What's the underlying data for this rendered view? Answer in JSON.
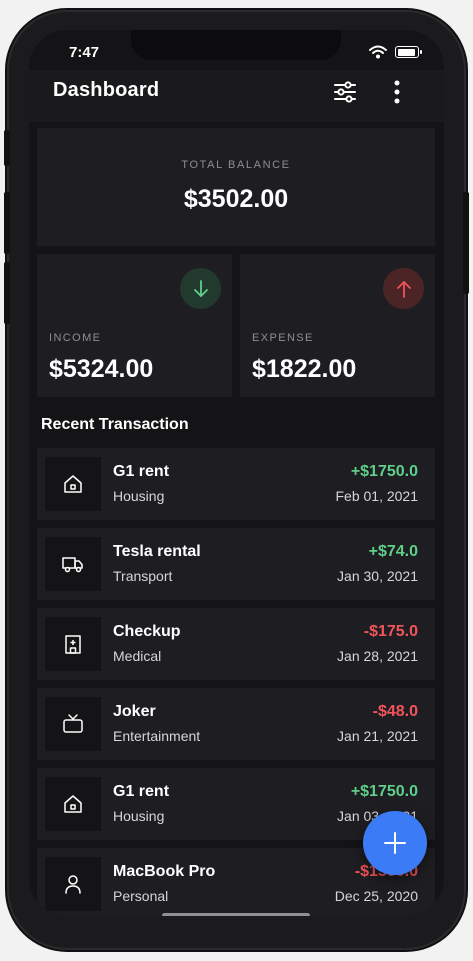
{
  "status_bar": {
    "time": "7:47"
  },
  "app_bar": {
    "title": "Dashboard",
    "filter_icon": "sliders-icon",
    "more_icon": "more-vertical-icon"
  },
  "balance": {
    "label": "TOTAL BALANCE",
    "value": "$3502.00"
  },
  "income": {
    "label": "INCOME",
    "value": "$5324.00",
    "icon": "arrow-down-icon",
    "color": "#5fcf8a"
  },
  "expense": {
    "label": "EXPENSE",
    "value": "$1822.00",
    "icon": "arrow-up-icon",
    "color": "#f2545b"
  },
  "recent": {
    "title": "Recent Transaction",
    "transactions": [
      {
        "name": "G1 rent",
        "category": "Housing",
        "amount": "+$1750.0",
        "date": "Feb 01, 2021",
        "icon": "house-icon",
        "positive": true
      },
      {
        "name": "Tesla rental",
        "category": "Transport",
        "amount": "+$74.0",
        "date": "Jan 30, 2021",
        "icon": "truck-icon",
        "positive": true
      },
      {
        "name": "Checkup",
        "category": "Medical",
        "amount": "-$175.0",
        "date": "Jan 28, 2021",
        "icon": "hospital-icon",
        "positive": false
      },
      {
        "name": "Joker",
        "category": "Entertainment",
        "amount": "-$48.0",
        "date": "Jan 21, 2021",
        "icon": "tv-icon",
        "positive": false
      },
      {
        "name": "G1 rent",
        "category": "Housing",
        "amount": "+$1750.0",
        "date": "Jan 03, 2021",
        "icon": "house-icon",
        "positive": true
      },
      {
        "name": "MacBook Pro",
        "category": "Personal",
        "amount": "-$1500.0",
        "date": "Dec 25, 2020",
        "icon": "person-icon",
        "positive": false
      }
    ]
  },
  "fab": {
    "icon": "plus-icon"
  },
  "colors": {
    "accent": "#3b7cf6",
    "positive": "#5fcf8a",
    "negative": "#f2545b",
    "background": "#141416",
    "card": "#1e1e22"
  }
}
